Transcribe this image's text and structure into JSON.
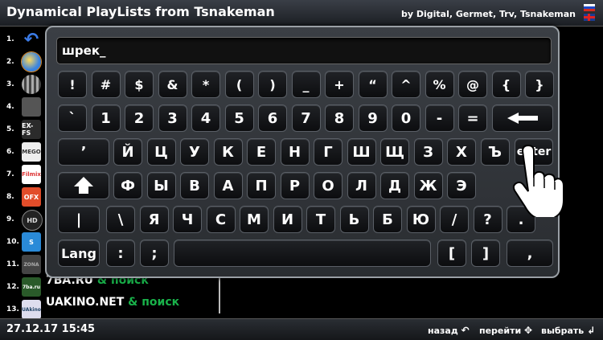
{
  "header": {
    "title": "Dynamical PlayLists from Tsnakeman",
    "credits": "by Digital, Germet, Trv, Tsnakeman"
  },
  "playlist": {
    "items": [
      {
        "num": "1.",
        "icon": "back-arrow-icon",
        "icon_text": "↶"
      },
      {
        "num": "2.",
        "icon": "globe-icon",
        "icon_text": ""
      },
      {
        "num": "3.",
        "icon": "film-reel-icon",
        "icon_text": ""
      },
      {
        "num": "4.",
        "icon": "mask-icon",
        "icon_text": ""
      },
      {
        "num": "5.",
        "icon": "exfs-icon",
        "icon_text": "EX-FS"
      },
      {
        "num": "6.",
        "icon": "mego-icon",
        "icon_text": "MEGO"
      },
      {
        "num": "7.",
        "icon": "filmix-icon",
        "icon_text": "Filmix"
      },
      {
        "num": "8.",
        "icon": "ofx-icon",
        "icon_text": "OFX"
      },
      {
        "num": "9.",
        "icon": "hd-icon",
        "icon_text": "HD"
      },
      {
        "num": "10.",
        "icon": "s-logo-icon",
        "icon_text": "S"
      },
      {
        "num": "11.",
        "icon": "zona-icon",
        "icon_text": "ZONA"
      },
      {
        "num": "12.",
        "icon": "7ba-icon",
        "icon_text": "7ba.ru",
        "name": "7BA.RU",
        "suffix": "& поиск"
      },
      {
        "num": "13.",
        "icon": "uakino-icon",
        "icon_text": "UAkino",
        "name": "UAKINO.NET",
        "suffix": "& поиск"
      }
    ]
  },
  "keyboard": {
    "input_value": "шрек_",
    "rows": [
      [
        "!",
        "#",
        "$",
        "&",
        "*",
        "(",
        ")",
        "_",
        "+",
        "“",
        "^",
        "%",
        "@",
        "{",
        "}"
      ],
      [
        "`",
        "1",
        "2",
        "3",
        "4",
        "5",
        "6",
        "7",
        "8",
        "9",
        "0",
        "-",
        "="
      ],
      [
        "’",
        "Й",
        "Ц",
        "У",
        "К",
        "Е",
        "Н",
        "Г",
        "Ш",
        "Щ",
        "З",
        "Х",
        "Ъ",
        "enter"
      ],
      [
        "Ф",
        "Ы",
        "В",
        "А",
        "П",
        "Р",
        "О",
        "Л",
        "Д",
        "Ж",
        "Э"
      ],
      [
        "|",
        "\\",
        "Я",
        "Ч",
        "С",
        "М",
        "И",
        "Т",
        "Ь",
        "Б",
        "Ю",
        "/",
        "?",
        "."
      ],
      [
        "Lang",
        ":",
        ";",
        "[",
        "]",
        ","
      ]
    ]
  },
  "footer": {
    "datetime": "27.12.17 15:45",
    "back_label": "назад",
    "nav_label": "перейти",
    "select_label": "выбрать"
  }
}
